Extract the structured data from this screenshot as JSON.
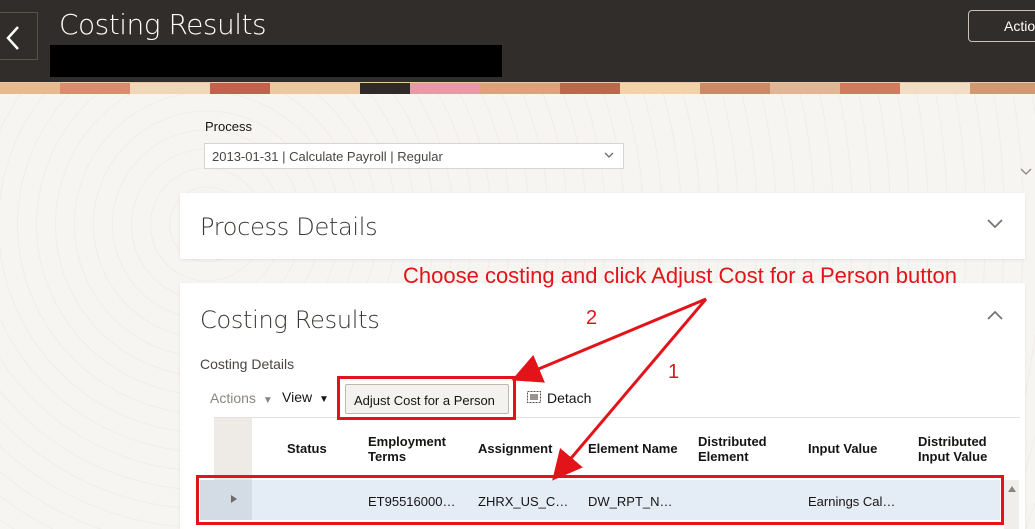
{
  "header": {
    "title": "Costing Results",
    "actions_label": "Actio"
  },
  "process": {
    "label": "Process",
    "value": "2013-01-31 | Calculate Payroll | Regular"
  },
  "sections": {
    "process_details_title": "Process Details",
    "costing_results_title": "Costing Results",
    "costing_details_label": "Costing Details"
  },
  "toolbar": {
    "actions_label": "Actions",
    "view_label": "View",
    "adjust_button_label": "Adjust Cost for a Person",
    "detach_label": "Detach"
  },
  "table": {
    "columns": {
      "status": "Status",
      "employment_terms_1": "Employment",
      "employment_terms_2": "Terms",
      "assignment": "Assignment",
      "element_name": "Element Name",
      "distributed_element_1": "Distributed",
      "distributed_element_2": "Element",
      "input_value": "Input Value",
      "distributed_input_value_1": "Distributed",
      "distributed_input_value_2": "Input Value"
    },
    "rows": [
      {
        "status": "",
        "employment_terms": "ET95516000…",
        "assignment": "ZHRX_US_C…",
        "element_name": "DW_RPT_N…",
        "distributed_element": "",
        "input_value": "Earnings Cal…",
        "distributed_input_value": ""
      }
    ]
  },
  "annotations": {
    "instruction": "Choose costing and click Adjust Cost for a Person button",
    "step_1": "1",
    "step_2": "2",
    "color": "#e2141a"
  }
}
